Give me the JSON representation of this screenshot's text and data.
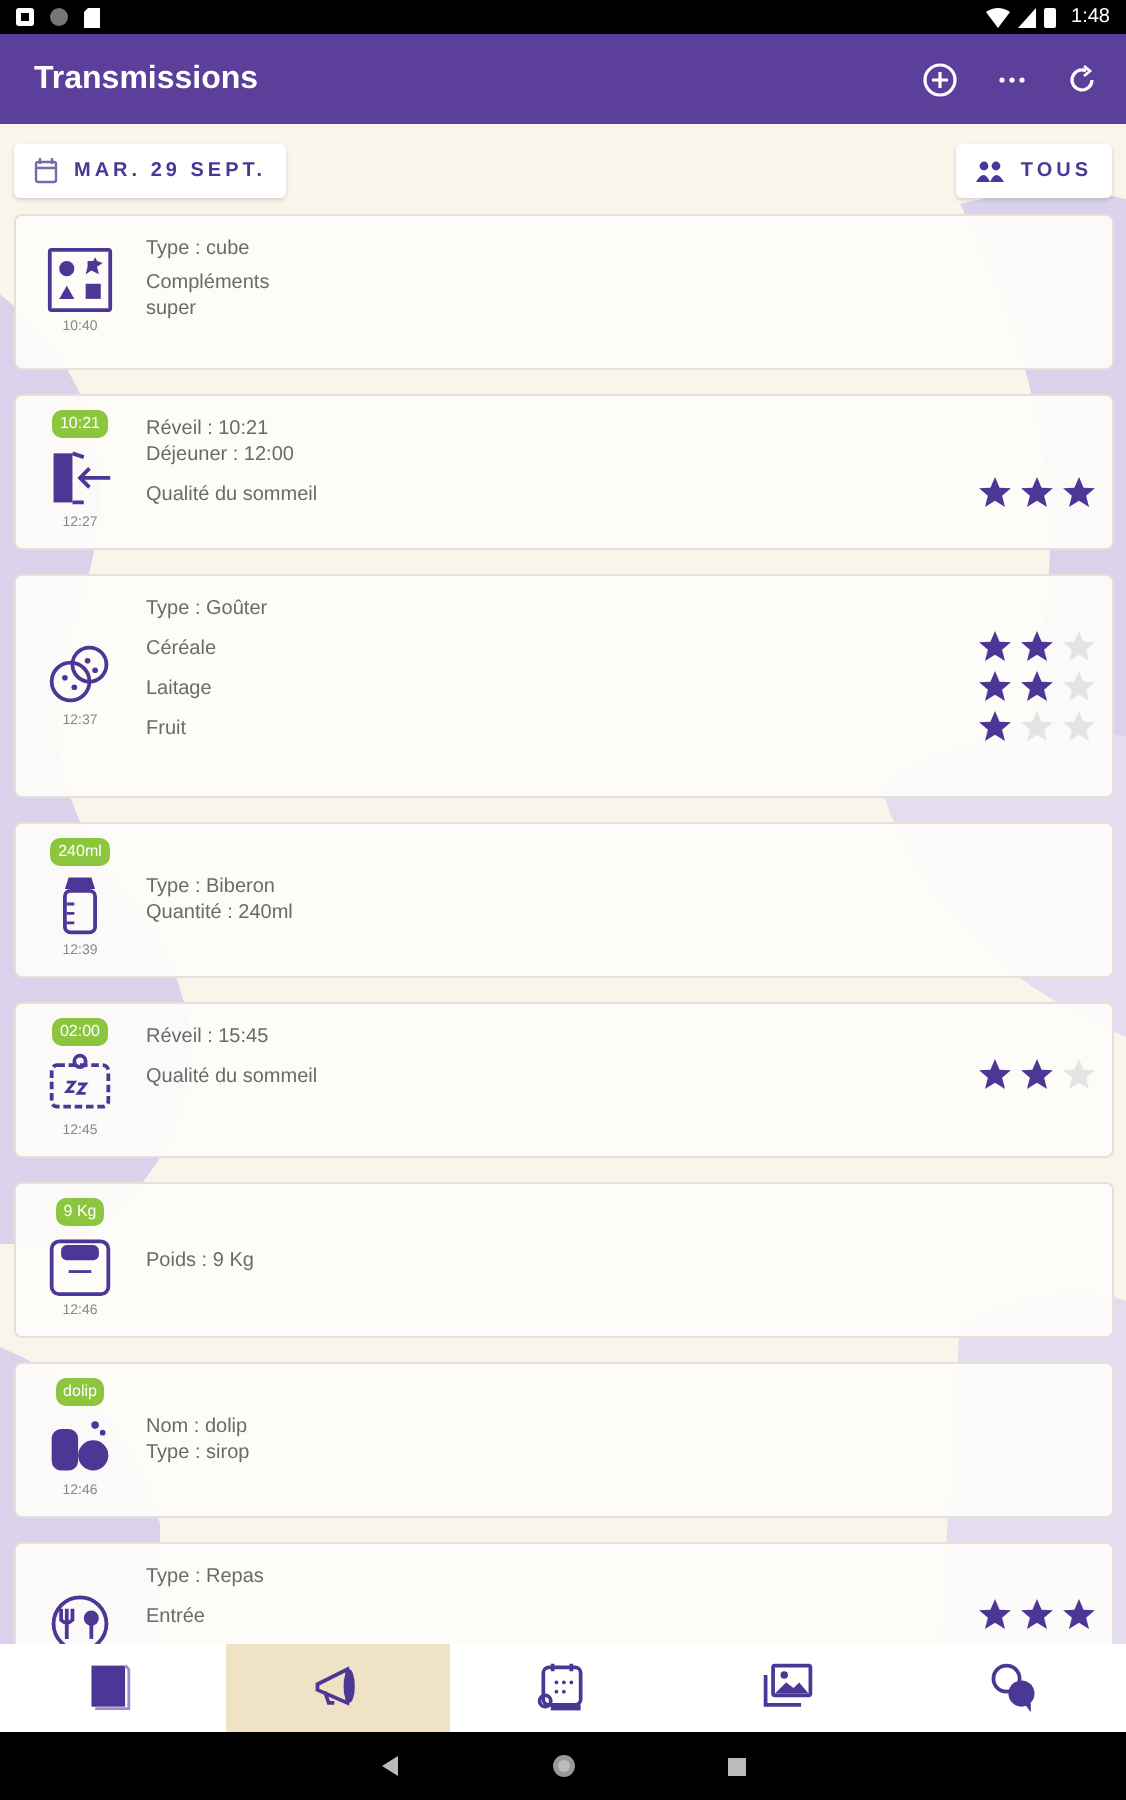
{
  "status_bar": {
    "time": "1:48"
  },
  "app_bar": {
    "title": "Transmissions"
  },
  "filters": {
    "date": "MAR. 29 SEPT.",
    "group": "TOUS"
  },
  "entries": [
    {
      "kind": "cube",
      "time": "10:40",
      "blocks": [
        {
          "lines": [
            "Type : cube"
          ]
        },
        {
          "lines": [
            "Compléments",
            "super"
          ]
        }
      ]
    },
    {
      "kind": "door",
      "badge": "10:21",
      "time": "12:27",
      "blocks": [
        {
          "lines": [
            "Réveil : 10:21",
            "Déjeuner : 12:00"
          ]
        },
        {
          "lines": [
            "Qualité du sommeil"
          ],
          "stars": 3
        }
      ]
    },
    {
      "kind": "cookie",
      "time": "12:37",
      "blocks": [
        {
          "lines": [
            "Type : Goûter"
          ]
        },
        {
          "lines": [
            "Céréale"
          ],
          "stars": 2
        },
        {
          "lines": [
            "Laitage"
          ],
          "stars": 2
        },
        {
          "lines": [
            "Fruit"
          ],
          "stars": 1
        }
      ]
    },
    {
      "kind": "bottle",
      "badge": "240ml",
      "time": "12:39",
      "blocks": [
        {
          "lines": [
            "Type : Biberon",
            "Quantité : 240ml"
          ]
        }
      ]
    },
    {
      "kind": "sleep",
      "badge": "02:00",
      "time": "12:45",
      "blocks": [
        {
          "lines": [
            "Réveil : 15:45"
          ]
        },
        {
          "lines": [
            "Qualité du sommeil"
          ],
          "stars": 2
        }
      ]
    },
    {
      "kind": "scale",
      "badge": "9 Kg",
      "time": "12:46",
      "blocks": [
        {
          "lines": [
            "Poids : 9 Kg"
          ]
        }
      ]
    },
    {
      "kind": "medicine",
      "badge": "dolip",
      "time": "12:46",
      "blocks": [
        {
          "lines": [
            "Nom : dolip",
            "Type : sirop"
          ]
        }
      ]
    },
    {
      "kind": "meal",
      "blocks": [
        {
          "lines": [
            "Type : Repas"
          ]
        },
        {
          "lines": [
            "Entrée"
          ],
          "stars": 3
        }
      ]
    }
  ],
  "bottom_nav": [
    {
      "kind": "book",
      "selected": false
    },
    {
      "kind": "megaphone",
      "selected": true
    },
    {
      "kind": "calendar",
      "selected": false
    },
    {
      "kind": "image",
      "selected": false
    },
    {
      "kind": "chat",
      "selected": false
    }
  ]
}
